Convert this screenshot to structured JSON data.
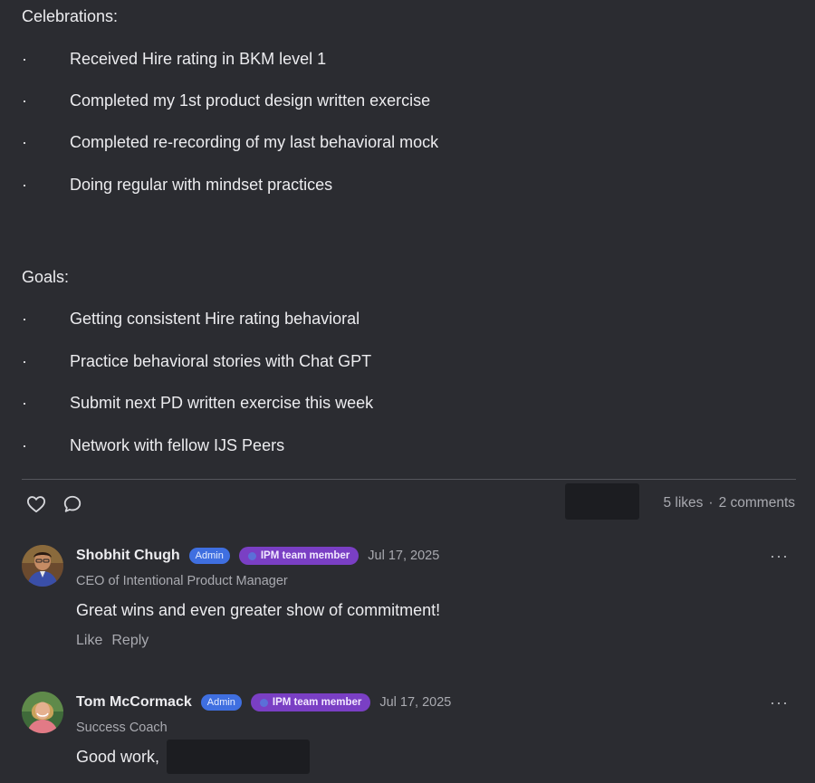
{
  "post": {
    "celebrations_heading": "Celebrations:",
    "celebrations": [
      "Received Hire rating in BKM level 1",
      "Completed my 1st product design written exercise",
      "Completed re-recording of my last behavioral mock",
      "Doing regular with mindset practices"
    ],
    "goals_heading": "Goals:",
    "goals": [
      "Getting consistent Hire rating behavioral",
      "Practice behavioral stories with Chat GPT",
      "Submit next PD written exercise this week",
      "Network with fellow IJS Peers"
    ],
    "bullet_char": "·"
  },
  "actions": {
    "like_icon": "heart-icon",
    "comment_icon": "comment-bubble-icon",
    "likes": "5 likes",
    "separator": "·",
    "comments": "2 comments"
  },
  "comments": [
    {
      "author": "Shobhit Chugh",
      "admin_badge": "Admin",
      "team_badge": "IPM team member",
      "date": "Jul 17, 2025",
      "subtitle": "CEO of Intentional Product Manager",
      "body": "Great wins and even greater show of commitment!",
      "like_label": "Like",
      "reply_label": "Reply",
      "more": "···"
    },
    {
      "author": "Tom McCormack",
      "admin_badge": "Admin",
      "team_badge": "IPM team member",
      "date": "Jul 17, 2025",
      "subtitle": "Success Coach",
      "body": "Good work,",
      "more": "···"
    }
  ],
  "colors": {
    "background": "#2b2c31",
    "admin_badge": "#3f6fe0",
    "team_badge": "#7a3fc4",
    "redaction": "#1c1d21"
  }
}
